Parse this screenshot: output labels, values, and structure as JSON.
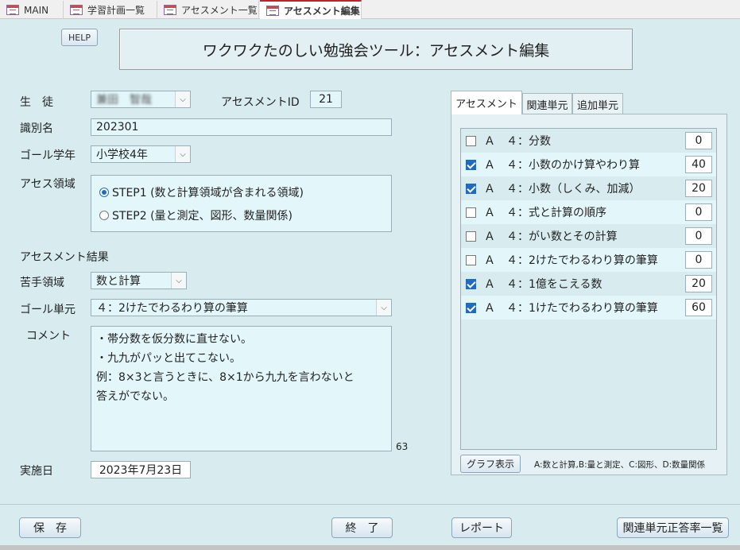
{
  "tabs": [
    {
      "label": "MAIN"
    },
    {
      "label": "学習計画一覧"
    },
    {
      "label": "アセスメント一覧"
    },
    {
      "label": "アセスメント編集"
    }
  ],
  "help_label": "HELP",
  "title": "ワクワクたのしい勉強会ツール：アセスメント編集",
  "form": {
    "student_label": "生　徒",
    "student_value": "兼田　智哉",
    "assessment_id_label": "アセスメントID",
    "assessment_id_value": "21",
    "identifier_label": "識別名",
    "identifier_value": "202301",
    "goal_grade_label": "ゴール学年",
    "goal_grade_value": "小学校4年",
    "area_label": "アセス領域",
    "step1_label": "STEP1 (数と計算領域が含まれる領域)",
    "step2_label": "STEP2 (量と測定、図形、数量関係)",
    "result_heading": "アセスメント結果",
    "weak_area_label": "苦手領域",
    "weak_area_value": "数と計算",
    "goal_unit_label": "ゴール単元",
    "goal_unit_value": "４：2けたでわるわり算の筆算",
    "comment_label": "コメント",
    "comment_lines": [
      "・帯分数を仮分数に直せない。",
      "・九九がパッと出てこない。",
      "例：8×3と言うときに、8×1から九九を言わないと",
      "答えがでない。"
    ],
    "comment_count": "63",
    "date_label": "実施日",
    "date_value": "2023年7月23日"
  },
  "right_tabs": [
    {
      "label": "アセスメント"
    },
    {
      "label": "関連単元"
    },
    {
      "label": "追加単元"
    }
  ],
  "assessment_items": [
    {
      "label": "Ａ　４：分数",
      "checked": false,
      "score": "0"
    },
    {
      "label": "Ａ　４：小数のかけ算やわり算",
      "checked": true,
      "score": "40"
    },
    {
      "label": "Ａ　４：小数（しくみ、加減）",
      "checked": true,
      "score": "20"
    },
    {
      "label": "Ａ　４：式と計算の順序",
      "checked": false,
      "score": "0"
    },
    {
      "label": "Ａ　４：がい数とその計算",
      "checked": false,
      "score": "0"
    },
    {
      "label": "Ａ　４：2けたでわるわり算の筆算",
      "checked": false,
      "score": "0"
    },
    {
      "label": "Ａ　４：1億をこえる数",
      "checked": true,
      "score": "20"
    },
    {
      "label": "Ａ　４：1けたでわるわり算の筆算",
      "checked": true,
      "score": "60"
    }
  ],
  "graph_button": "グラフ表示",
  "legend_note": "A:数と計算,B:量と測定、C:図形、D:数量関係",
  "footer": {
    "save": "保　存",
    "exit": "終　了",
    "report": "レポート",
    "rate_list": "関連単元正答率一覧"
  }
}
